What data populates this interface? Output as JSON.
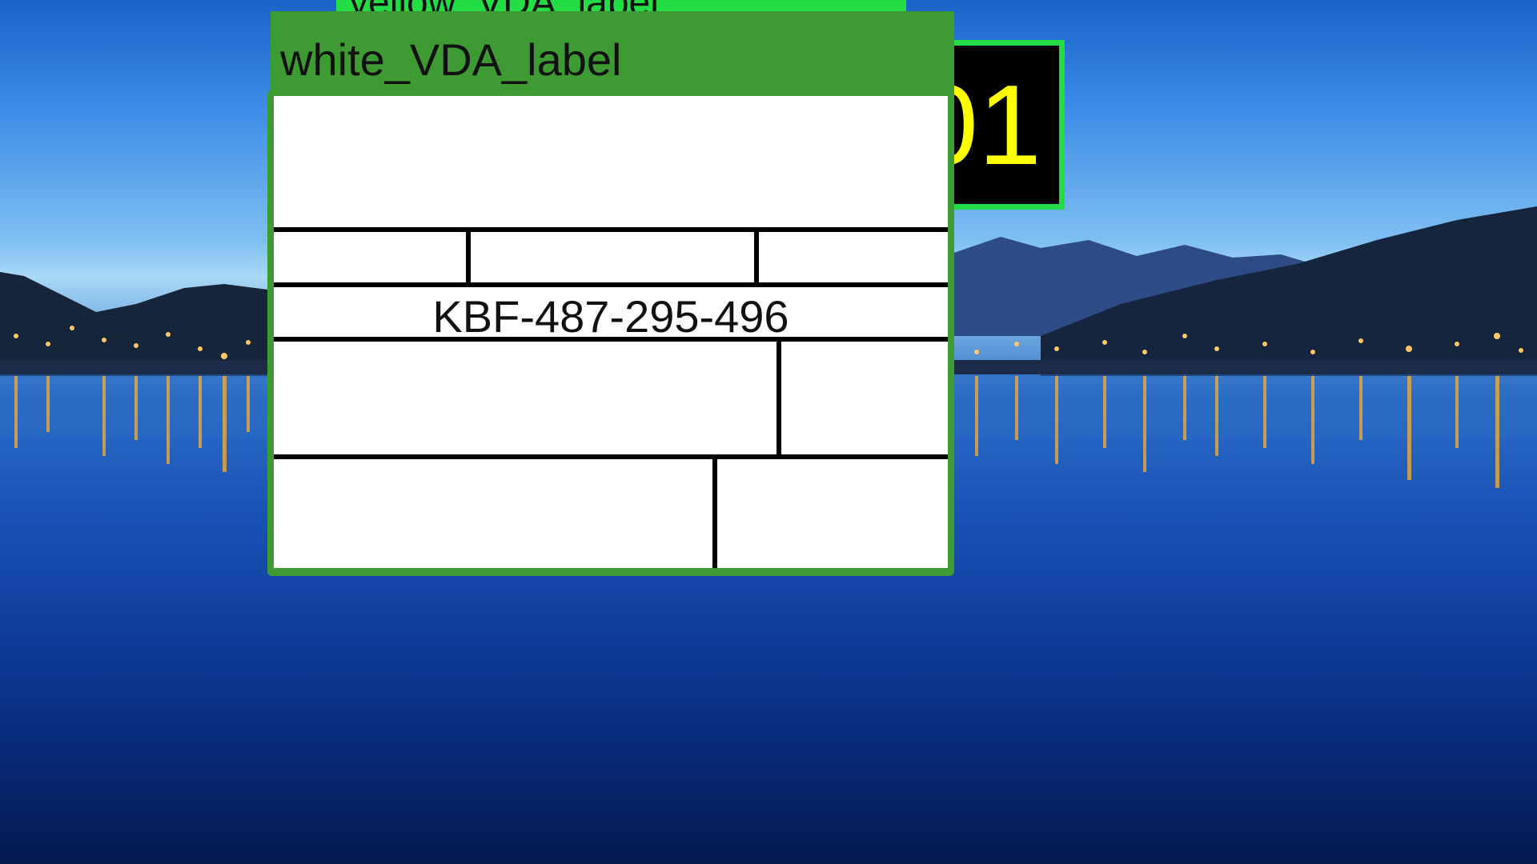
{
  "desktop": {
    "wallpaper": "lake-night-cityscape"
  },
  "windows": {
    "yellow": {
      "title": "yellow_VDA_label",
      "title_color": "#22dd44",
      "body_color": "#ffff00"
    },
    "white": {
      "title": "white_VDA_label",
      "title_color": "#3e9a33",
      "code": "KBF-487-295-496"
    }
  },
  "counter": {
    "text": "01",
    "text_color": "#ffff00",
    "border_color": "#22dd44"
  }
}
